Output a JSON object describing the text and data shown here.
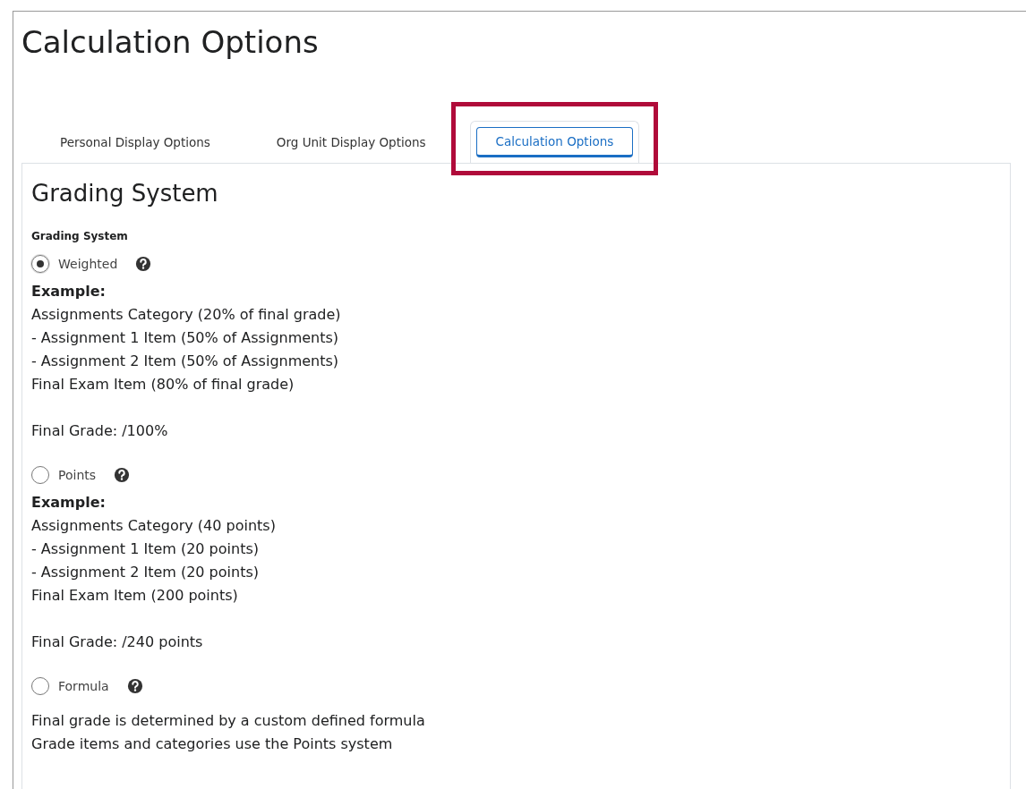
{
  "title": "Calculation Options",
  "tabs": [
    {
      "label": "Personal Display Options",
      "selected": false
    },
    {
      "label": "Org Unit Display Options",
      "selected": false
    },
    {
      "label": "Calculation Options",
      "selected": true
    }
  ],
  "highlight_selected_tab": true,
  "section": {
    "heading": "Grading System",
    "field_label": "Grading System",
    "options": [
      {
        "label": "Weighted",
        "selected": true,
        "example_heading": "Example:",
        "lines": [
          "Assignments Category (20% of final grade)",
          "- Assignment 1 Item (50% of Assignments)",
          "- Assignment 2 Item (50% of Assignments)",
          "Final Exam Item (80% of final grade)"
        ],
        "total": "Final Grade: /100%"
      },
      {
        "label": "Points",
        "selected": false,
        "example_heading": "Example:",
        "lines": [
          "Assignments Category (40 points)",
          "- Assignment 1 Item (20 points)",
          "- Assignment 2 Item (20 points)",
          "Final Exam Item (200 points)"
        ],
        "total": "Final Grade: /240 points"
      },
      {
        "label": "Formula",
        "selected": false,
        "lines": [
          "Final grade is determined by a custom defined formula",
          "Grade items and categories use the Points system"
        ]
      }
    ]
  }
}
